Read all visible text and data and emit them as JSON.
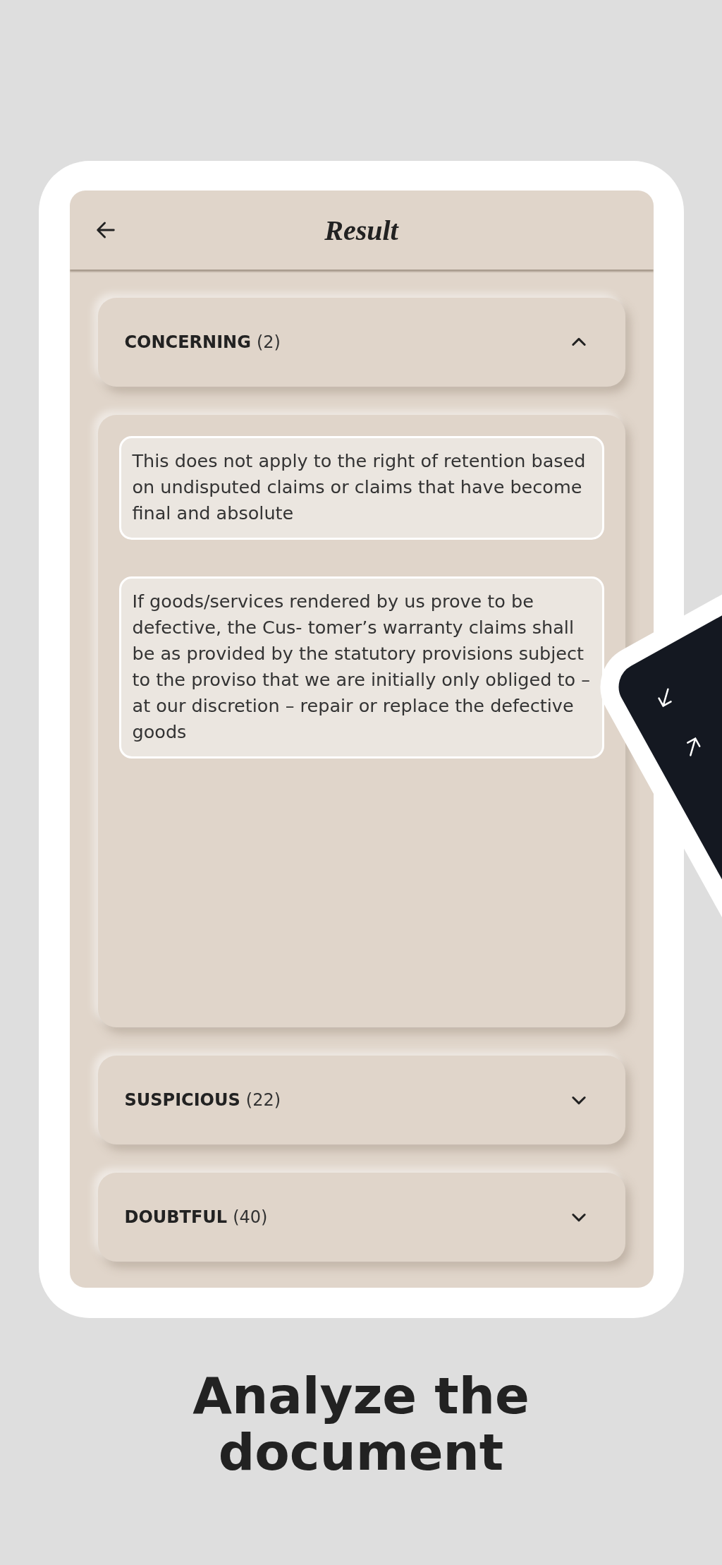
{
  "header": {
    "title": "Result"
  },
  "sections": [
    {
      "title": "CONCERNING",
      "count": "(2)",
      "expanded": true,
      "items": [
        "This does not apply to the right of retention based on undisputed claims or claims that have become final and absolute",
        "If goods/services rendered by us prove to be defective, the Cus- tomer’s warranty claims shall be as provided by the statutory provisions subject to the proviso that we are initially only obliged to – at our discretion – repair or replace the defective goods"
      ]
    },
    {
      "title": "SUSPICIOUS",
      "count": "(22)",
      "expanded": false
    },
    {
      "title": "DOUBTFUL",
      "count": "(40)",
      "expanded": false
    }
  ],
  "caption": "Analyze the document"
}
